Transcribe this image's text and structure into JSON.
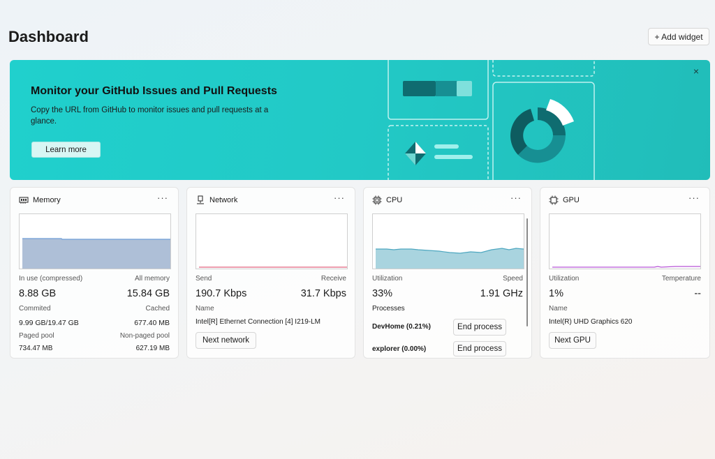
{
  "header": {
    "title": "Dashboard",
    "add_widget_label": "+ Add widget"
  },
  "banner": {
    "title": "Monitor your GitHub Issues and Pull Requests",
    "description": "Copy the URL from GitHub to monitor issues and pull requests at a glance.",
    "learn_more_label": "Learn more",
    "close_icon": "×"
  },
  "widgets": {
    "memory": {
      "title": "Memory",
      "more": "···",
      "in_use_label": "In use (compressed)",
      "all_memory_label": "All memory",
      "in_use_value": "8.88 GB",
      "all_memory_value": "15.84 GB",
      "committed_label": "Commited",
      "cached_label": "Cached",
      "committed_value": "9.99 GB/19.47 GB",
      "cached_value": "677.40 MB",
      "paged_label": "Paged pool",
      "nonpaged_label": "Non-paged pool",
      "paged_value": "734.47 MB",
      "nonpaged_value": "627.19 MB"
    },
    "network": {
      "title": "Network",
      "more": "···",
      "send_label": "Send",
      "receive_label": "Receive",
      "send_value": "190.7 Kbps",
      "receive_value": "31.7 Kbps",
      "name_label": "Name",
      "name_value": "Intel[R] Ethernet Connection [4] I219-LM",
      "next_label": "Next network"
    },
    "cpu": {
      "title": "CPU",
      "more": "···",
      "utilization_label": "Utilization",
      "speed_label": "Speed",
      "utilization_value": "33%",
      "speed_value": "1.91 GHz",
      "processes_label": "Processes",
      "processes": [
        {
          "name": "DevHome (0.21%)",
          "action": "End process"
        },
        {
          "name": "explorer (0.00%)",
          "action": "End process"
        }
      ]
    },
    "gpu": {
      "title": "GPU",
      "more": "···",
      "utilization_label": "Utilization",
      "temperature_label": "Temperature",
      "utilization_value": "1%",
      "temperature_value": "--",
      "name_label": "Name",
      "name_value": "Intel(R) UHD Graphics 620",
      "next_label": "Next GPU"
    }
  },
  "colors": {
    "banner_teal": "#22c9c6",
    "memory_fill": "#a9bcd6",
    "memory_line": "#6f9ed7",
    "network_line": "#e0607e",
    "cpu_fill": "#a8d3de",
    "cpu_line": "#4ea7c0",
    "gpu_line": "#b653d6"
  }
}
